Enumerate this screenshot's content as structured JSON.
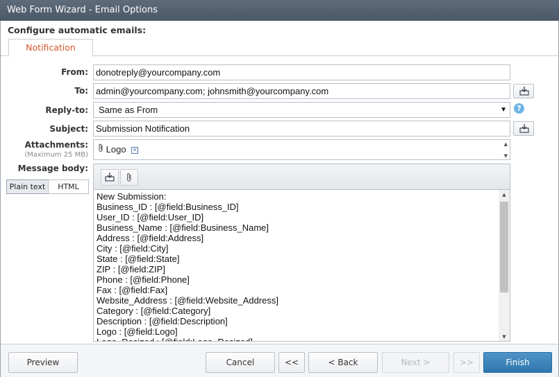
{
  "window": {
    "title": "Web Form Wizard - Email Options"
  },
  "heading": "Configure automatic emails:",
  "tabs": [
    {
      "label": "Notification"
    }
  ],
  "form": {
    "from": {
      "label": "From:",
      "value": "donotreply@yourcompany.com"
    },
    "to": {
      "label": "To:",
      "value": "admin@yourcompany.com; johnsmith@yourcompany.com"
    },
    "reply_to": {
      "label": "Reply-to:",
      "value": "Same as From"
    },
    "subject": {
      "label": "Subject:",
      "value": "Submission Notification"
    },
    "attachments": {
      "label": "Attachments:",
      "sublabel": "(Maximum 25 MB)",
      "items": [
        {
          "name": "Logo"
        }
      ]
    },
    "message_body": {
      "label": "Message body:",
      "modes": [
        "Plain text",
        "HTML"
      ],
      "selected_mode": "Plain text",
      "lines": [
        "New Submission:",
        "Business_ID : [@field:Business_ID]",
        "User_ID : [@field:User_ID]",
        "Business_Name : [@field:Business_Name]",
        "Address : [@field:Address]",
        "City : [@field:City]",
        "State : [@field:State]",
        "ZIP : [@field:ZIP]",
        "Phone : [@field:Phone]",
        "Fax : [@field:Fax]",
        "Website_Address : [@field:Website_Address]",
        "Category : [@field:Category]",
        "Description : [@field:Description]",
        "Logo : [@field:Logo]",
        "Logo_Resized : [@field:Logo_Resized]"
      ]
    }
  },
  "footer": {
    "preview": "Preview",
    "cancel": "Cancel",
    "first": "<<",
    "back": "< Back",
    "next": "Next >",
    "last": ">>",
    "finish": "Finish"
  },
  "colors": {
    "accent": "#d6572a",
    "primary_button": "#2e77ae",
    "titlebar": "#4b5867",
    "help": "#6cb4e4"
  },
  "icons": {
    "insert_field": "insert-field-icon",
    "attachment": "paperclip-icon",
    "remove": "close-icon",
    "help": "help-icon",
    "dropdown": "chevron-down-icon"
  }
}
